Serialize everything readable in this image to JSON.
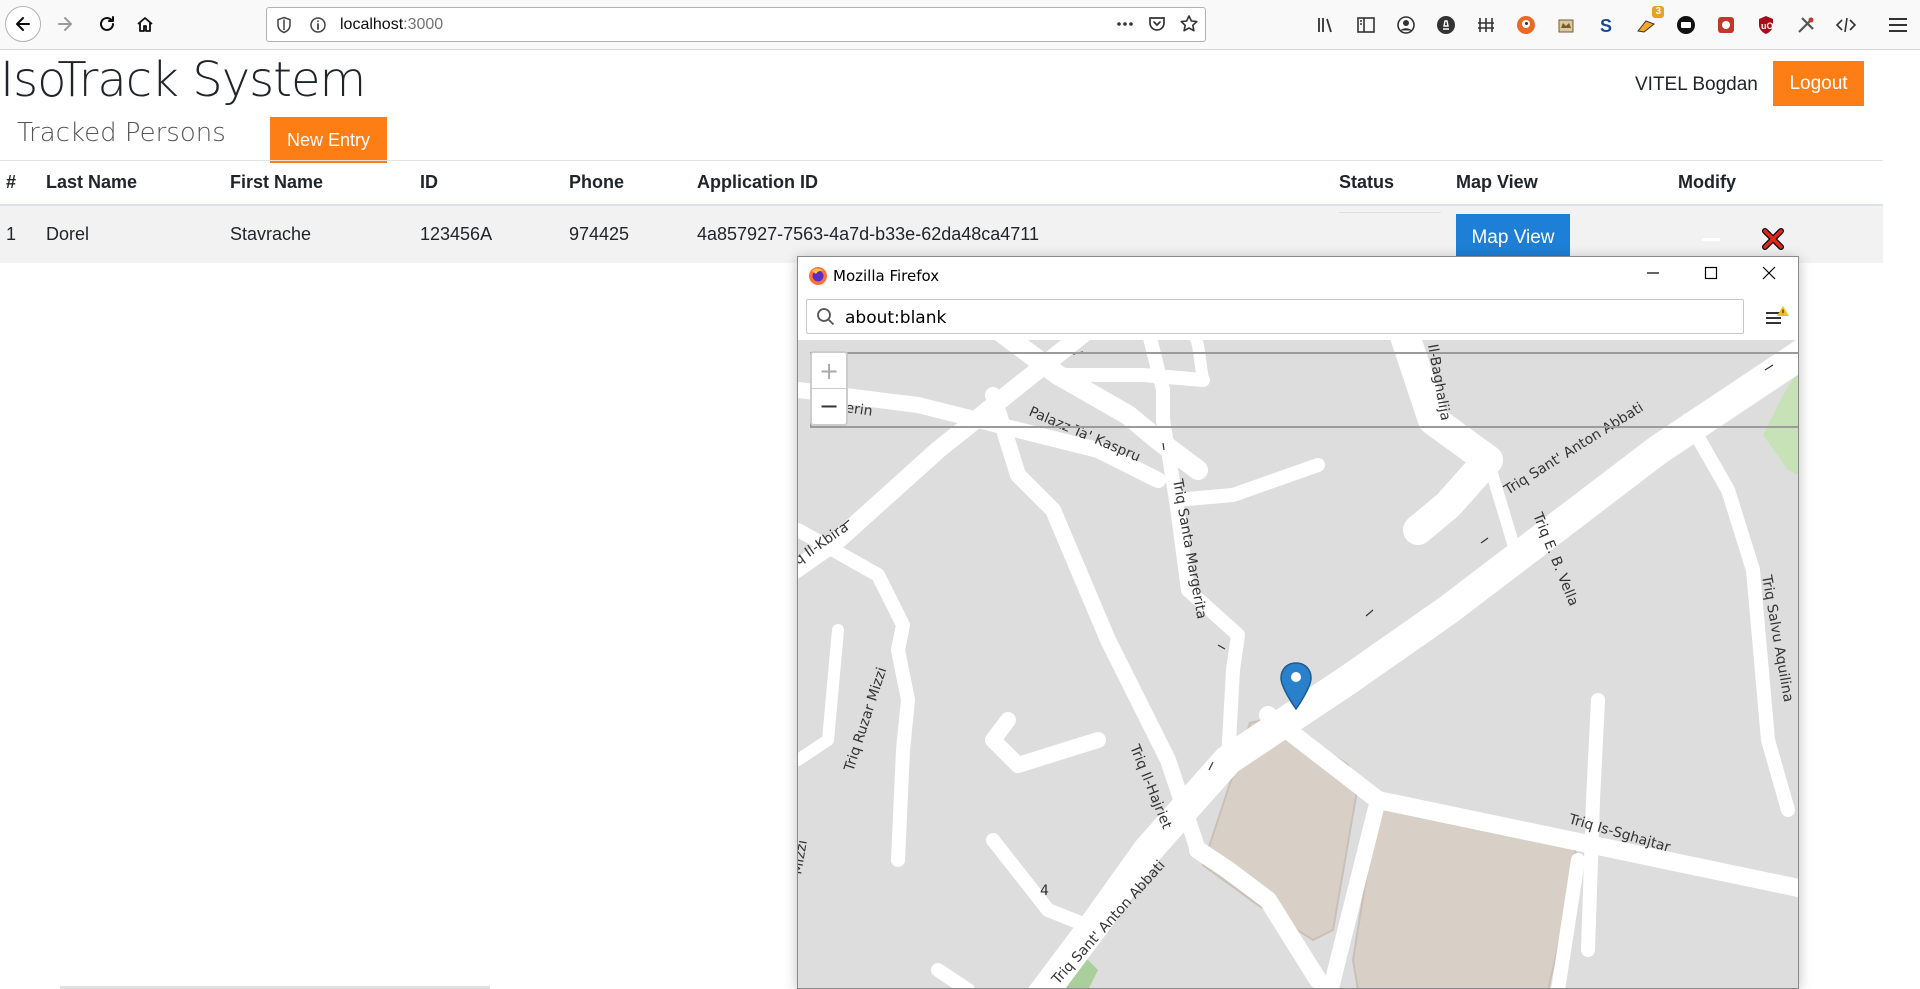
{
  "browser": {
    "url_host": "localhost",
    "url_port": ":3000",
    "extension_badge": "3"
  },
  "app": {
    "title": "IsoTrack System",
    "user_name": "VITEL Bogdan",
    "logout_label": "Logout",
    "section_title": "Tracked Persons",
    "new_entry_label": "New Entry",
    "accent_color": "#fd7e14",
    "primary_color": "#1e7fd6"
  },
  "table": {
    "headers": {
      "num": "#",
      "last_name": "Last Name",
      "first_name": "First Name",
      "id": "ID",
      "phone": "Phone",
      "application_id": "Application ID",
      "status": "Status",
      "map_view": "Map View",
      "modify": "Modify"
    },
    "rows": [
      {
        "num": "1",
        "last_name": "Dorel",
        "first_name": "Stavrache",
        "id": "123456A",
        "phone": "974425",
        "application_id": "4a857927-7563-4a7d-b33e-62da48ca4711",
        "status": "",
        "map_view_label": "Map View"
      }
    ]
  },
  "popup": {
    "window_title": "Mozilla Firefox",
    "url": "about:blank",
    "zoom_in": "+",
    "zoom_out": "−",
    "map_labels": {
      "erin": "erin",
      "palazz": "Palazz Ta' Kaspru",
      "ilbaghalija": "Il-Baghalija",
      "antonabbati_top": "Triq Sant' Anton Abbati",
      "ebvella": "Triq E. B. Vella",
      "santamargerita": "Triq Santa Margerita",
      "ilkbira": "q Il-Kbira",
      "salvu": "Triq Salvu Aquilina",
      "ruzar": "Triq Ruzar Mizzi",
      "mizzi": "Mizzi",
      "ilhajriet": "Triq Il-Hajriet",
      "sghajtar": "Triq Is-Sghajtar",
      "antonabbati_bottom": "Triq Sant' Anton Abbati",
      "four": "4"
    }
  }
}
